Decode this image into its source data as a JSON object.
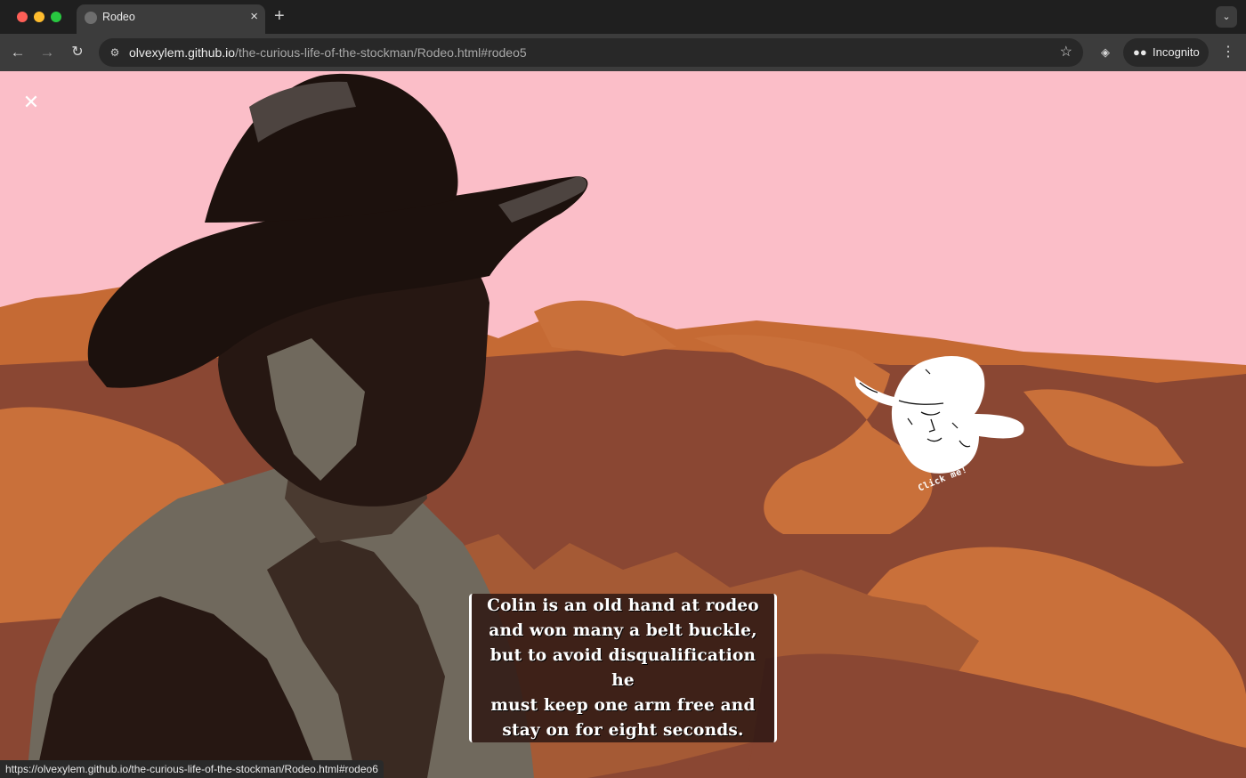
{
  "browser": {
    "tab": {
      "title": "Rodeo",
      "close_icon": "close-icon"
    },
    "new_tab_label": "+",
    "address_bar": {
      "host": "olvexylem.github.io",
      "path": "/the-curious-life-of-the-stockman/Rodeo.html#rodeo5"
    },
    "profile": {
      "label": "Incognito",
      "icon": "incognito-icon"
    }
  },
  "page": {
    "close_label": "✕",
    "hat_button": {
      "label": "Click me!",
      "icon": "cowboy-hat-face-icon"
    },
    "caption": {
      "lines": [
        "Colin is an old hand at rodeo",
        "and won many a belt buckle,",
        "but to avoid disqualification he",
        "must keep one arm free and",
        "stay on for eight seconds."
      ]
    },
    "colors": {
      "sky": "#fbbec8",
      "ground_dark": "#8a4733",
      "ground_light": "#c9703a",
      "figure_dark": "#261712",
      "figure_mid": "#70695d"
    }
  },
  "status_bar": {
    "text": "https://olvexylem.github.io/the-curious-life-of-the-stockman/Rodeo.html#rodeo6"
  }
}
